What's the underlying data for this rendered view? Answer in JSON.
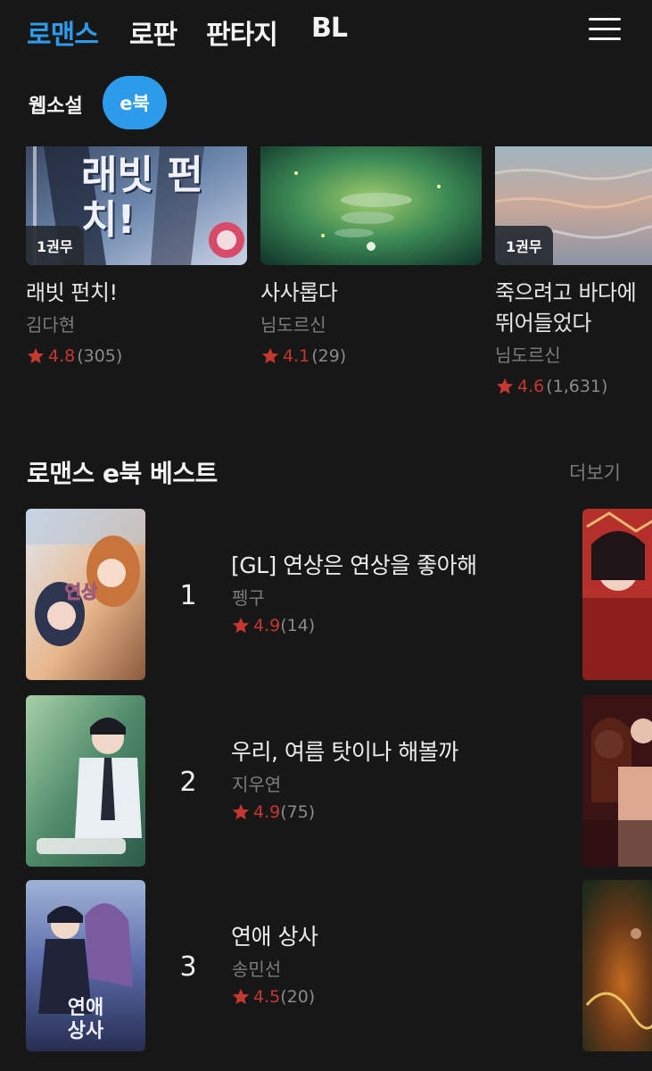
{
  "nav": {
    "tabs": [
      "로맨스",
      "로판",
      "판타지",
      "BL"
    ],
    "active_tab": "로맨스",
    "menu_icon": "hamburger-menu-icon"
  },
  "subtabs": {
    "webnovel": "웹소설",
    "ebook": "e북",
    "active": "e북"
  },
  "carousel": [
    {
      "title": "래빗 펀치!",
      "author": "김다현",
      "rating": "4.8",
      "count": "(305)",
      "badge": "1권무",
      "cover_text": "래빗 펀치!"
    },
    {
      "title": "사사롭다",
      "author": "님도르신",
      "rating": "4.1",
      "count": "(29)"
    },
    {
      "title": "죽으려고 바다에 뛰어들었다",
      "author": "님도르신",
      "rating": "4.6",
      "count": "(1,631)",
      "badge": "1권무"
    }
  ],
  "best": {
    "title": "로맨스 e북 베스트",
    "more": "더보기",
    "items": [
      {
        "rank": "1",
        "title": "[GL] 연상은 연상을 좋아해",
        "author": "펭구",
        "rating": "4.9",
        "count": "(14)"
      },
      {
        "rank": "2",
        "title": "우리, 여름 탓이나 해볼까",
        "author": "지우연",
        "rating": "4.9",
        "count": "(75)"
      },
      {
        "rank": "3",
        "title": "연애 상사",
        "author": "송민선",
        "rating": "4.5",
        "count": "(20)"
      }
    ]
  },
  "colors": {
    "accent": "#2e9bea",
    "background": "#171717",
    "star": "#c5382f"
  }
}
